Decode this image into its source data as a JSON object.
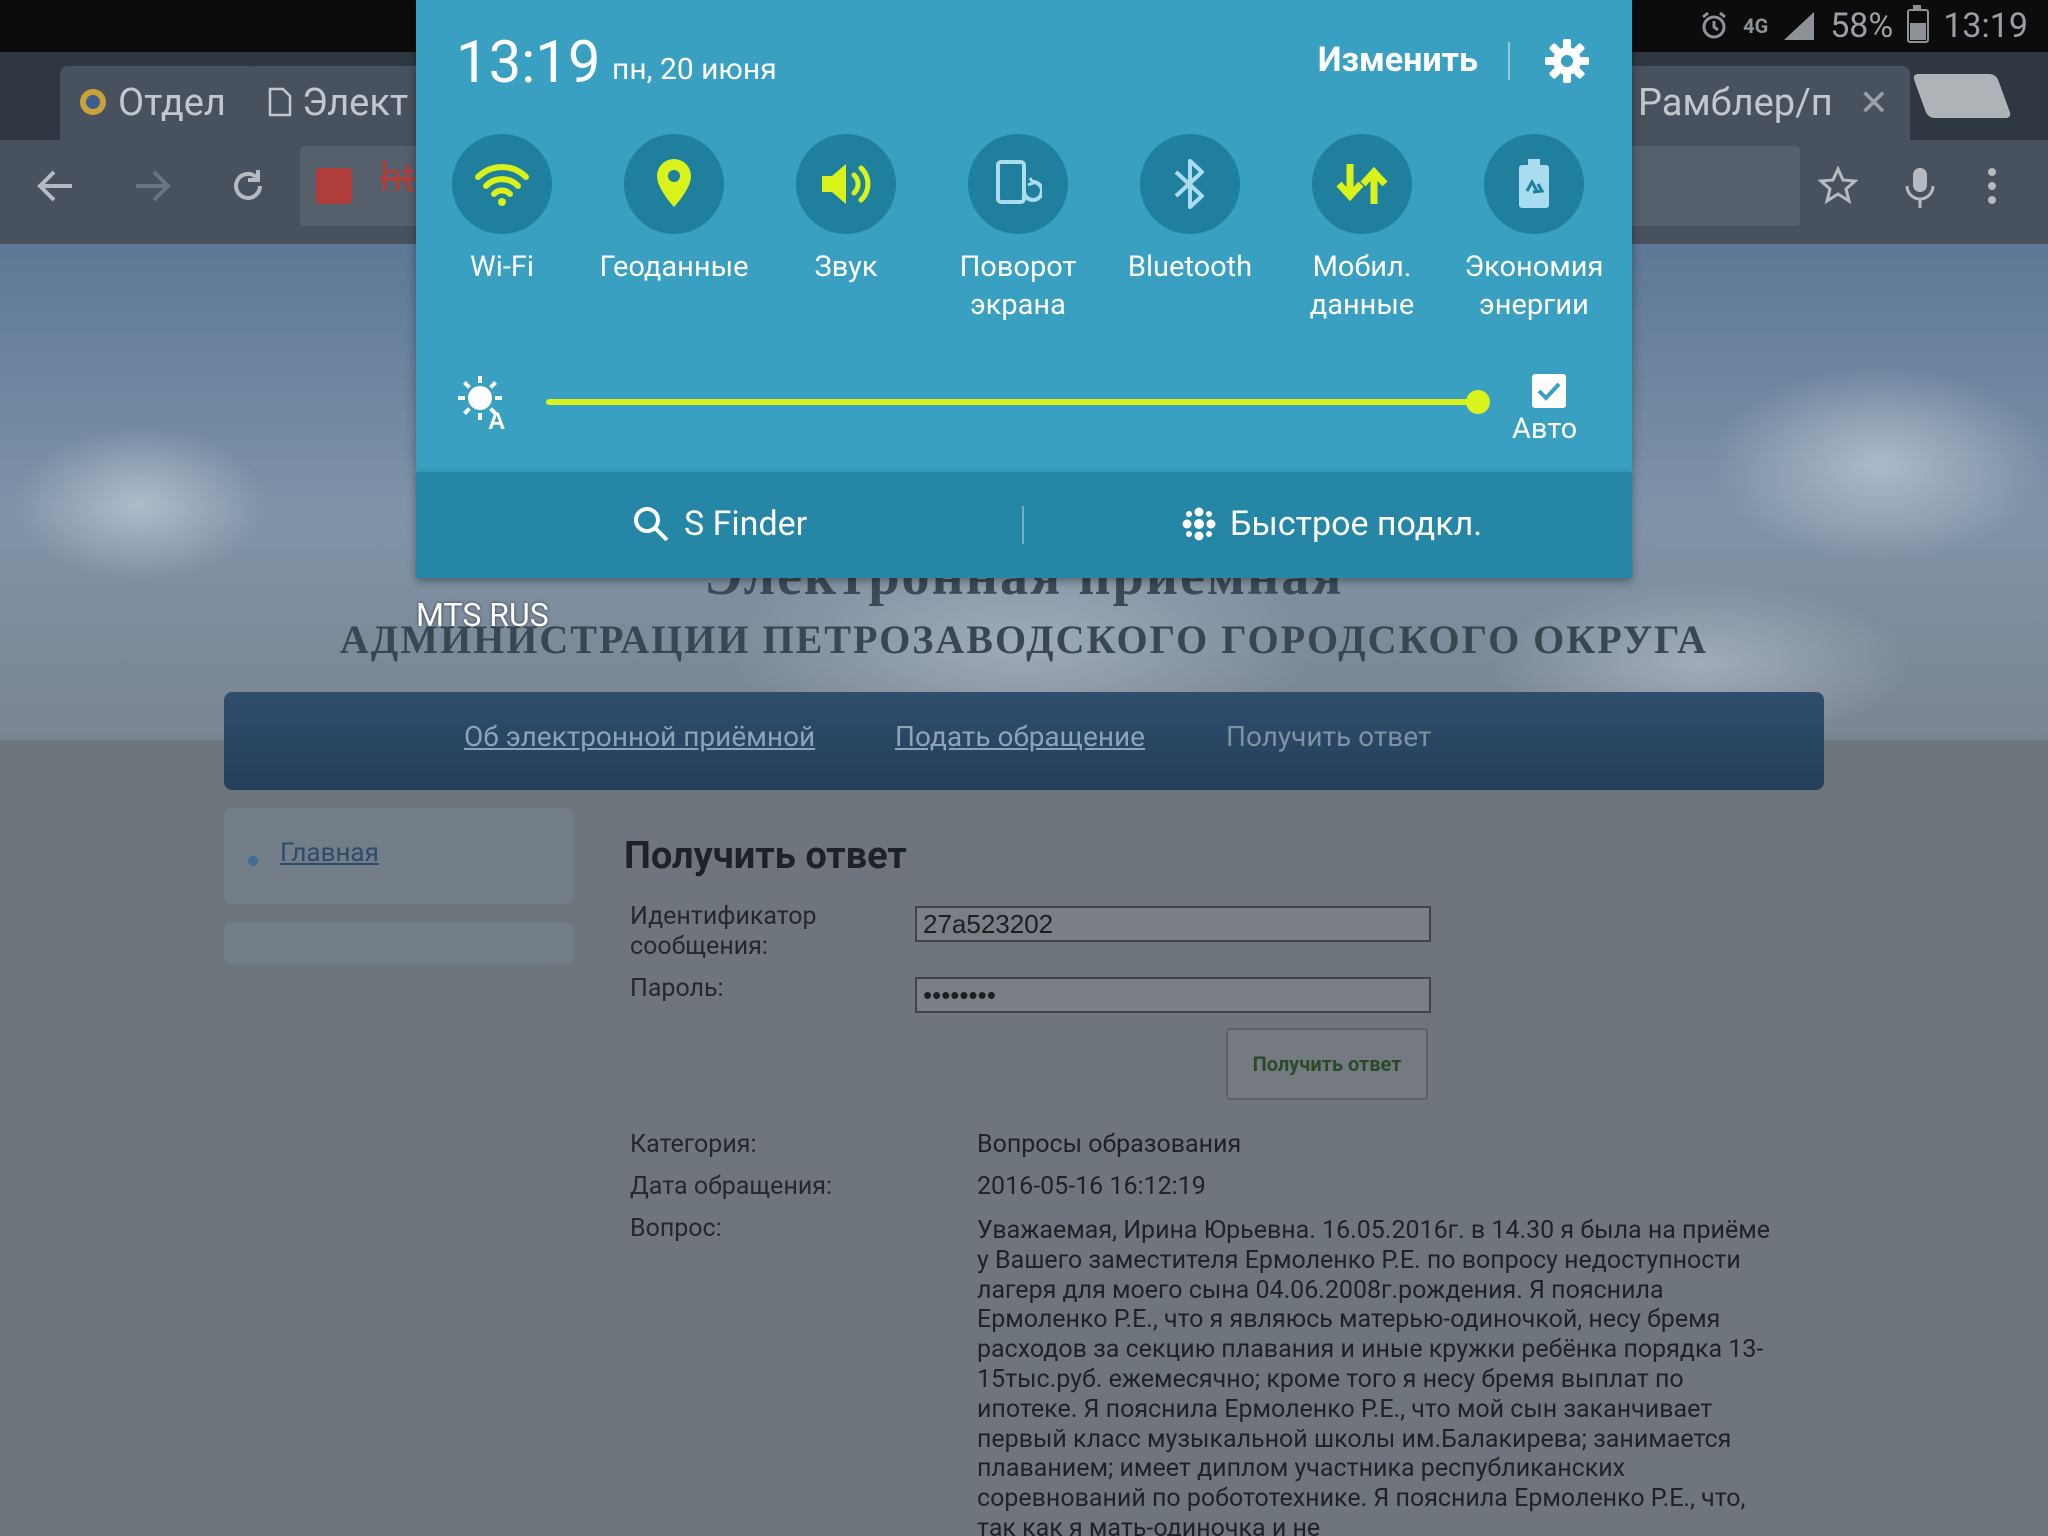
{
  "status_bar": {
    "battery": "58%",
    "time": "13:19",
    "network": "4G"
  },
  "browser": {
    "tabs": [
      {
        "label": "Отдел"
      },
      {
        "label": "Элект"
      },
      {
        "label": "Рамблер/п"
      }
    ],
    "url_text": "ht"
  },
  "page": {
    "header_line1": "Электронная приемная",
    "header_line2": "АДМИНИСТРАЦИИ ПЕТРОЗАВОДСКОГО ГОРОДСКОГО ОКРУГА",
    "nav": [
      {
        "label": "Об электронной приёмной"
      },
      {
        "label": "Подать обращение"
      },
      {
        "label": "Получить ответ"
      }
    ],
    "sidebar_link": "Главная",
    "title": "Получить ответ",
    "id_label": "Идентификатор\nсообщения:",
    "id_value": "27a523202",
    "password_label": "Пароль:",
    "password_value": "••••••••",
    "submit_label": "Получить ответ",
    "category_label": "Категория:",
    "category_value": "Вопросы образования",
    "date_label": "Дата обращения:",
    "date_value": "2016-05-16 16:12:19",
    "question_label": "Вопрос:",
    "question_text": "Уважаемая, Ирина Юрьевна. 16.05.2016г. в 14.30 я была на приёме у Вашего заместителя Ермоленко Р.Е. по вопросу недоступности лагеря для моего сына 04.06.2008г.рождения. Я пояснила Ермоленко Р.Е., что я являюсь матерью-одиночкой, несу бремя расходов за секцию плавания и иные кружки ребёнка порядка 13-15тыс.руб. ежемесячно; кроме того я несу бремя выплат по ипотеке. Я пояснила Ермоленко Р.Е., что мой сын заканчивает первый класс музыкальной школы им.Балакирева; занимается плаванием; имеет диплом участника республиканских соревнований по робототехнике. Я пояснила Ермоленко Р.Е., что, так как я мать-одиночка и не"
  },
  "panel": {
    "time": "13:19",
    "date": "пн, 20 июня",
    "edit_label": "Изменить",
    "toggles": [
      {
        "label": "Wi-Fi",
        "icon": "wifi-icon"
      },
      {
        "label": "Геоданные",
        "icon": "location-icon"
      },
      {
        "label": "Звук",
        "icon": "sound-icon"
      },
      {
        "label": "Поворот\nэкрана",
        "icon": "rotate-icon"
      },
      {
        "label": "Bluetooth",
        "icon": "bluetooth-icon"
      },
      {
        "label": "Мобил.\nданные",
        "icon": "mobile-data-icon"
      },
      {
        "label": "Экономия\nэнергии",
        "icon": "power-saving-icon"
      }
    ],
    "brightness": {
      "level": 1.0,
      "auto_label": "Авто",
      "auto_checked": true
    },
    "sfinder_label": "S Finder",
    "quick_connect_label": "Быстрое подкл.",
    "carrier": "MTS RUS"
  },
  "colors": {
    "panel": "#3aa0c2",
    "panel_bottom": "#2586a6",
    "accent": "#d8f21a"
  }
}
